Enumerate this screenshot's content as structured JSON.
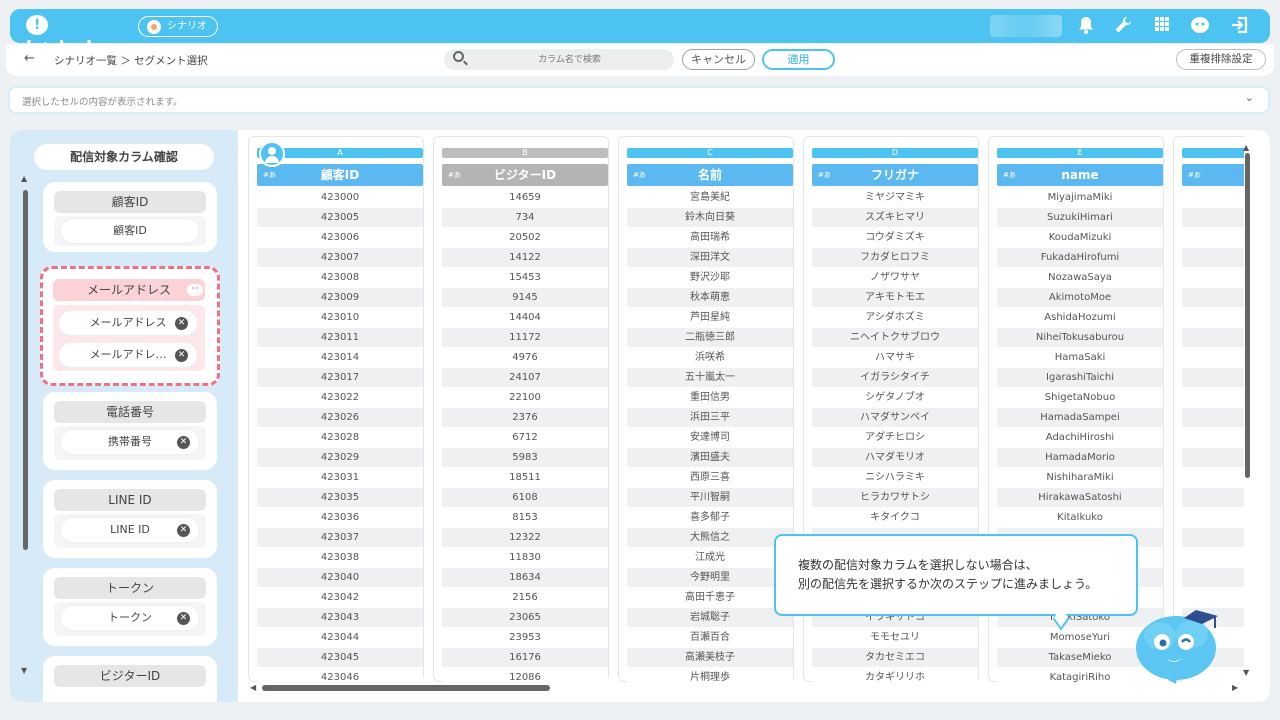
{
  "header": {
    "logo": "b+dash",
    "scenario_label": "シナリオ"
  },
  "toolbar": {
    "back": "←",
    "breadcrumb": "シナリオ一覧 ＞ セグメント選択",
    "search_placeholder": "カラム名で検索",
    "cancel": "キャンセル",
    "apply": "適用",
    "dedupe": "重複排除設定"
  },
  "cellbar": {
    "placeholder": "選択したセルの内容が表示されます。"
  },
  "sidebar": {
    "title": "配信対象カラム確認",
    "cards": [
      {
        "head": "顧客ID",
        "items": [
          "顧客ID"
        ]
      },
      {
        "head": "メールアドレス",
        "items": [
          "メールアドレス",
          "メールアドレ…"
        ]
      },
      {
        "head": "電話番号",
        "items": [
          "携帯番号"
        ]
      },
      {
        "head": "LINE ID",
        "items": [
          "LINE ID"
        ]
      },
      {
        "head": "トークン",
        "items": [
          "トークン"
        ]
      },
      {
        "head": "ビジターID",
        "items": []
      }
    ]
  },
  "table": {
    "columns": [
      {
        "letter": "A",
        "name": "顧客ID",
        "type": "#あ",
        "values": [
          "423000",
          "423005",
          "423006",
          "423007",
          "423008",
          "423009",
          "423010",
          "423011",
          "423014",
          "423017",
          "423022",
          "423026",
          "423028",
          "423029",
          "423031",
          "423035",
          "423036",
          "423037",
          "423038",
          "423040",
          "423042",
          "423043",
          "423044",
          "423045",
          "423046"
        ]
      },
      {
        "letter": "B",
        "name": "ビジターID",
        "type": "#あ",
        "values": [
          "14659",
          "734",
          "20502",
          "14122",
          "15453",
          "9145",
          "14404",
          "11172",
          "4976",
          "24107",
          "22100",
          "2376",
          "6712",
          "5983",
          "18511",
          "6108",
          "8153",
          "12322",
          "11830",
          "18634",
          "2156",
          "23065",
          "23953",
          "16176",
          "12086"
        ]
      },
      {
        "letter": "C",
        "name": "名前",
        "type": "#あ",
        "values": [
          "宮島美紀",
          "鈴木向日葵",
          "高田瑞希",
          "深田洋文",
          "野沢沙耶",
          "秋本萌恵",
          "芦田星純",
          "二瓶徳三郎",
          "浜咲希",
          "五十嵐太一",
          "重田信男",
          "浜田三平",
          "安達博司",
          "濱田盛夫",
          "西原三喜",
          "平川智嗣",
          "喜多郁子",
          "大熊信之",
          "江成光",
          "今野明里",
          "高田千恵子",
          "岩城聡子",
          "百瀬百合",
          "高瀬美枝子",
          "片桐理歩"
        ]
      },
      {
        "letter": "D",
        "name": "フリガナ",
        "type": "#あ",
        "values": [
          "ミヤジマミキ",
          "スズキヒマリ",
          "コウダミズキ",
          "フカダヒロフミ",
          "ノザワサヤ",
          "アキモトモエ",
          "アシダホズミ",
          "ニヘイトクサブロウ",
          "ハマサキ",
          "イガラシタイチ",
          "シゲタノブオ",
          "ハマダサンペイ",
          "アダチヒロシ",
          "ハマダモリオ",
          "ニシハラミキ",
          "ヒラカワサトシ",
          "キタイクコ",
          "",
          "",
          "",
          "",
          "イワキサトコ",
          "モモセユリ",
          "タカセミエコ",
          "カタギリリホ"
        ]
      },
      {
        "letter": "E",
        "name": "name",
        "type": "#あ",
        "values": [
          "MiyajimaMiki",
          "SuzukiHimari",
          "KoudaMizuki",
          "FukadaHirofumi",
          "NozawaSaya",
          "AkimotoMoe",
          "AshidaHozumi",
          "NiheiTokusaburou",
          "HamaSaki",
          "IgarashiTaichi",
          "ShigetaNobuo",
          "HamadaSampei",
          "AdachiHiroshi",
          "HamadaMorio",
          "NishiharaMiki",
          "HirakawaSatoshi",
          "KitaIkuko",
          "",
          "",
          "",
          "",
          "IwakiSatoko",
          "MomoseYuri",
          "TakaseMieko",
          "KatagiriRiho"
        ]
      },
      {
        "letter": "",
        "name": "",
        "type": "#あ",
        "values": []
      }
    ]
  },
  "tooltip": {
    "line1": "複数の配信対象カラムを選択しない場合は、",
    "line2": "別の配信先を選択するか次のステップに進みましょう。"
  },
  "colors": {
    "accent": "#4cc3f0",
    "header_blue": "#5bb8f0",
    "email_highlight": "#f07085"
  }
}
